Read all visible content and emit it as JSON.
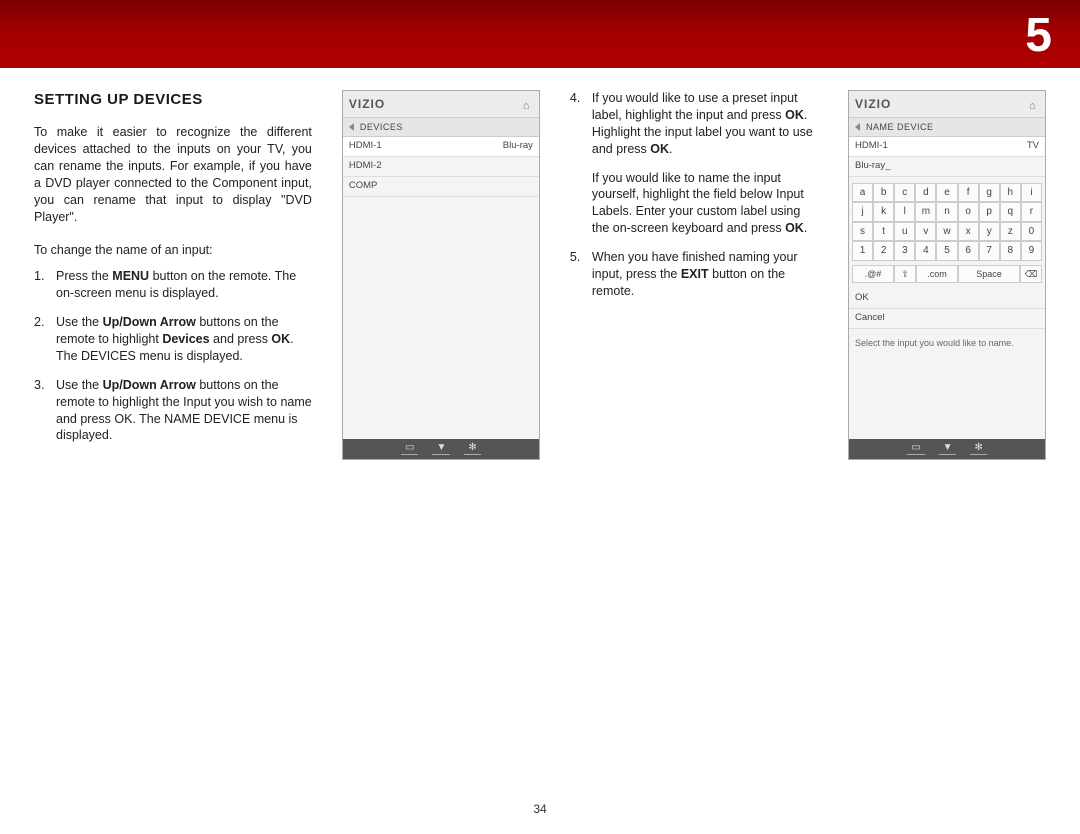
{
  "chapter": "5",
  "page_number": "34",
  "section_title": "SETTING UP DEVICES",
  "intro": "To make it easier to recognize the different devices attached to the inputs on your TV, you can rename the inputs. For example, if you have a DVD player connected to the Component input, you can rename that input to display \"DVD Player\".",
  "lead": "To change the name of an input:",
  "steps_left": [
    {
      "pre": "Press the ",
      "bold": "MENU",
      "post": " button on the remote. The on-screen menu is displayed."
    },
    {
      "pre": "Use the ",
      "bold": "Up/Down Arrow",
      "post": " buttons on the remote to highlight ",
      "bold2": "Devices",
      "post2": " and press ",
      "bold3": "OK",
      "post3": ". The DEVICES menu is displayed."
    },
    {
      "pre": "Use the ",
      "bold": "Up/Down Arrow",
      "post": " buttons on the remote to highlight the Input you wish to name and press OK. The NAME DEVICE menu is displayed."
    }
  ],
  "steps_mid": [
    {
      "num": "4.",
      "text_a": "If you would like to use a preset input label, highlight the input and press ",
      "b1": "OK",
      "text_b": ". Highlight the input label you want to use and press ",
      "b2": "OK",
      "text_c": "."
    },
    {
      "num": "",
      "text_a": "If you would like to name the input yourself, highlight the field below Input Labels. Enter your custom label using the on-screen keyboard and press ",
      "b1": "OK",
      "text_b": ".",
      "b2": "",
      "text_c": ""
    },
    {
      "num": "5.",
      "text_a": "When you have finished naming your input, press the ",
      "b1": "EXIT",
      "text_b": " button on the remote.",
      "b2": "",
      "text_c": ""
    }
  ],
  "screen1": {
    "logo": "VIZIO",
    "crumb": "DEVICES",
    "rows": [
      {
        "l": "HDMI-1",
        "r": "Blu-ray"
      },
      {
        "l": "HDMI-2",
        "r": ""
      },
      {
        "l": "COMP",
        "r": ""
      }
    ]
  },
  "screen2": {
    "logo": "VIZIO",
    "crumb": "NAME DEVICE",
    "rows": [
      {
        "l": "HDMI-1",
        "r": "TV"
      },
      {
        "l": "Blu-ray_",
        "r": ""
      }
    ],
    "keys_rows": [
      [
        "a",
        "b",
        "c",
        "d",
        "e",
        "f",
        "g",
        "h",
        "i"
      ],
      [
        "j",
        "k",
        "l",
        "m",
        "n",
        "o",
        "p",
        "q",
        "r"
      ],
      [
        "s",
        "t",
        "u",
        "v",
        "w",
        "x",
        "y",
        "z",
        "0"
      ],
      [
        "1",
        "2",
        "3",
        "4",
        "5",
        "6",
        "7",
        "8",
        "9"
      ]
    ],
    "keys_bottom": {
      "k1": ".@#",
      "k2": "⇧",
      "k3": ".com",
      "k4": "Space",
      "k5": "⌫"
    },
    "actions": [
      "OK",
      "Cancel"
    ],
    "hint": "Select the input you would like to name."
  }
}
